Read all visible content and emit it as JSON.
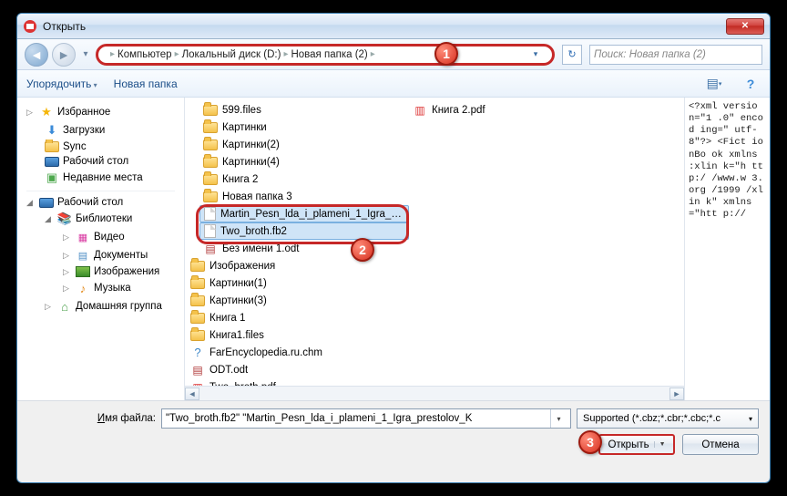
{
  "window": {
    "title": "Открыть"
  },
  "breadcrumb": {
    "items": [
      "Компьютер",
      "Локальный диск (D:)",
      "Новая папка (2)"
    ]
  },
  "search": {
    "placeholder": "Поиск: Новая папка (2)"
  },
  "toolbar": {
    "organize": "Упорядочить",
    "newfolder": "Новая папка"
  },
  "sidebar": {
    "fav": "Избранное",
    "fav_items": [
      "Загрузки",
      "Sync",
      "Рабочий стол",
      "Недавние места"
    ],
    "desktop": "Рабочий стол",
    "libs": "Библиотеки",
    "lib_items": [
      "Видео",
      "Документы",
      "Изображения",
      "Музыка"
    ],
    "homegroup": "Домашняя группа"
  },
  "files": {
    "col1": [
      {
        "icon": "folder",
        "name": "599.files"
      },
      {
        "icon": "folder",
        "name": "Картинки"
      },
      {
        "icon": "folder",
        "name": "Картинки(2)"
      },
      {
        "icon": "folder",
        "name": "Картинки(4)"
      },
      {
        "icon": "folder",
        "name": "Книга 2"
      },
      {
        "icon": "folder",
        "name": "Новая папка 3"
      },
      {
        "icon": "page",
        "name": "Martin_Pesn_lda_i_plameni_1_Igra_p...",
        "sel": true
      },
      {
        "icon": "page",
        "name": "Two_broth.fb2",
        "sel": true
      },
      {
        "icon": "odt",
        "name": "Без имени 1.odt"
      }
    ],
    "col2": [
      {
        "icon": "folder",
        "name": "Изображения"
      },
      {
        "icon": "folder",
        "name": "Картинки(1)"
      },
      {
        "icon": "folder",
        "name": "Картинки(3)"
      },
      {
        "icon": "folder",
        "name": "Книга 1"
      },
      {
        "icon": "folder",
        "name": "Книга1.files"
      },
      {
        "icon": "chm",
        "name": "FarEncyclopedia.ru.chm"
      },
      {
        "icon": "odt",
        "name": "ODT.odt"
      },
      {
        "icon": "pdf",
        "name": "Two_broth.pdf"
      },
      {
        "icon": "pdf",
        "name": "Книга 2.pdf"
      }
    ]
  },
  "preview_text": "<?xml\nversio\nn=\"1\n.0\"\nencod\ning=\"\nutf-\n8\"?>\n<Fict\nionBo\nok\nxmlns\n:xlin\nk=\"h\nttp:/\n/www.w\n3.org\n/1999\n/xlin\nk\"\nxmlns\n=\"htt\np://",
  "footer": {
    "filename_label": "Имя файла:",
    "filename_value": "\"Two_broth.fb2\" \"Martin_Pesn_lda_i_plameni_1_Igra_prestolov_K",
    "filter": "Supported (*.cbz;*.cbr;*.cbc;*.c",
    "open": "Открыть",
    "cancel": "Отмена"
  },
  "markers": {
    "m1": "1",
    "m2": "2",
    "m3": "3"
  }
}
